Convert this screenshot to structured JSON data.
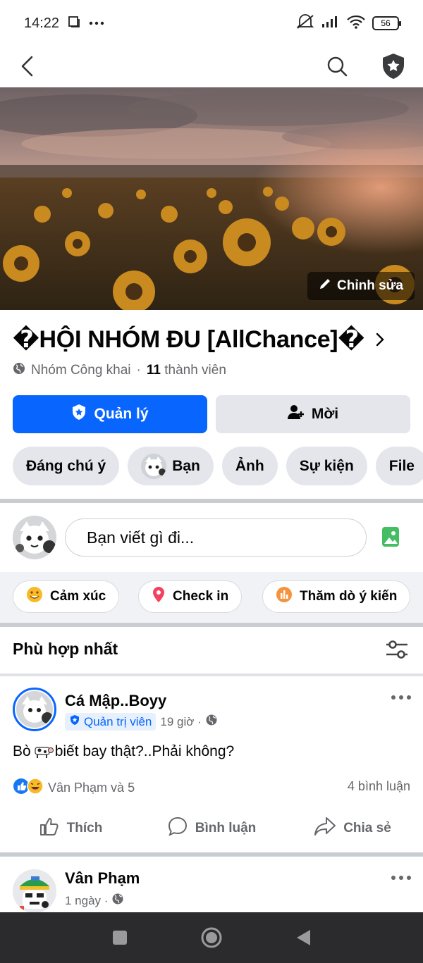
{
  "status_bar": {
    "time": "14:22",
    "battery": "56",
    "icons": [
      "screen-icon",
      "more-dots-icon",
      "mute-icon",
      "signal-icon",
      "wifi-icon",
      "battery-icon"
    ]
  },
  "top_nav": {
    "icons": [
      "back-chevron-icon",
      "search-icon",
      "admin-badge-icon"
    ]
  },
  "cover": {
    "edit_label": "Chỉnh sửa"
  },
  "group": {
    "name": "�HỘI NHÓM ĐU [AllChance]�",
    "privacy": "Nhóm Công khai",
    "separator": "·",
    "members_count": "11",
    "members_label": "thành viên"
  },
  "actions": {
    "manage_label": "Quản lý",
    "invite_label": "Mời"
  },
  "chips": [
    {
      "label": "Đáng chú ý"
    },
    {
      "label": "Bạn"
    },
    {
      "label": "Ảnh"
    },
    {
      "label": "Sự kiện"
    },
    {
      "label": "File"
    }
  ],
  "composer": {
    "placeholder": "Bạn viết gì đi..."
  },
  "quick_actions": {
    "feeling": "Cảm xúc",
    "checkin": "Check in",
    "poll": "Thăm dò ý kiến"
  },
  "feed": {
    "sort_title": "Phù hợp nhất"
  },
  "post1": {
    "author": "Cá Mập..Boyy",
    "role": "Quản trị viên",
    "time": "19 giờ ·",
    "text_before": "Bò",
    "text_after": " biết bay thật?..Phải không?",
    "reactions": "Vân Phạm và 5",
    "comments": "4 bình luận",
    "like": "Thích",
    "comment": "Bình luận",
    "share": "Chia sẻ"
  },
  "post2": {
    "author": "Vân Phạm",
    "time": "1 ngày ·"
  },
  "colors": {
    "accent": "#0866ff",
    "chip_bg": "#e4e6eb",
    "secondary_text": "#65676b",
    "navbar_bg": "#2b2b2d"
  }
}
